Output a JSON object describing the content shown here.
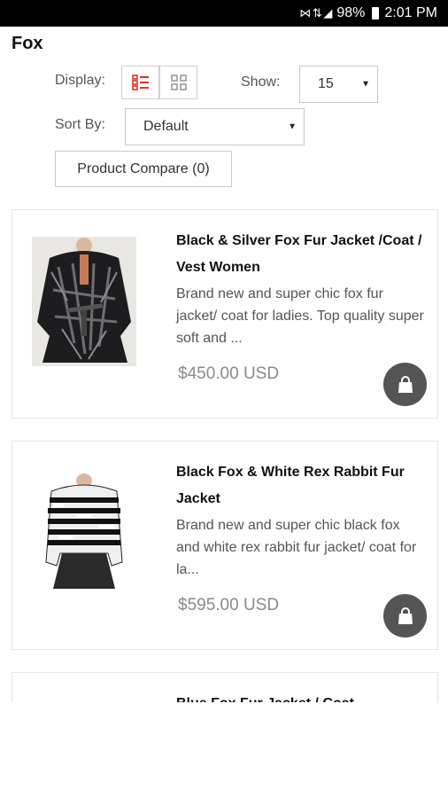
{
  "status_bar": {
    "signal_icons": "⋈ ⇅ ◢",
    "battery": "98%",
    "time": "2:01 PM"
  },
  "page": {
    "title": "Fox"
  },
  "toolbar": {
    "display_label": "Display:",
    "show_label": "Show:",
    "show_value": "15",
    "sort_label": "Sort By:",
    "sort_value": "Default",
    "compare_label": "Product Compare (0)"
  },
  "products": [
    {
      "title": "Black & Silver Fox Fur Jacket /Coat / Vest Women",
      "description": " Brand new and super chic fox fur jacket/ coat for ladies.  Top quality super soft and ...",
      "price": "$450.00 USD"
    },
    {
      "title": "Black Fox & White Rex Rabbit Fur Jacket",
      "description": " Brand new and super chic black fox and white rex rabbit fur jacket/ coat for la...",
      "price": "$595.00 USD"
    },
    {
      "title": "Blue Fox Fur Jacket / Coat"
    }
  ],
  "icons": {
    "list_view": "list-view-icon",
    "grid_view": "grid-view-icon",
    "cart": "shopping-bag-icon"
  },
  "colors": {
    "accent": "#d9342b",
    "cart_button": "#555555",
    "price": "#8a8a8a"
  }
}
